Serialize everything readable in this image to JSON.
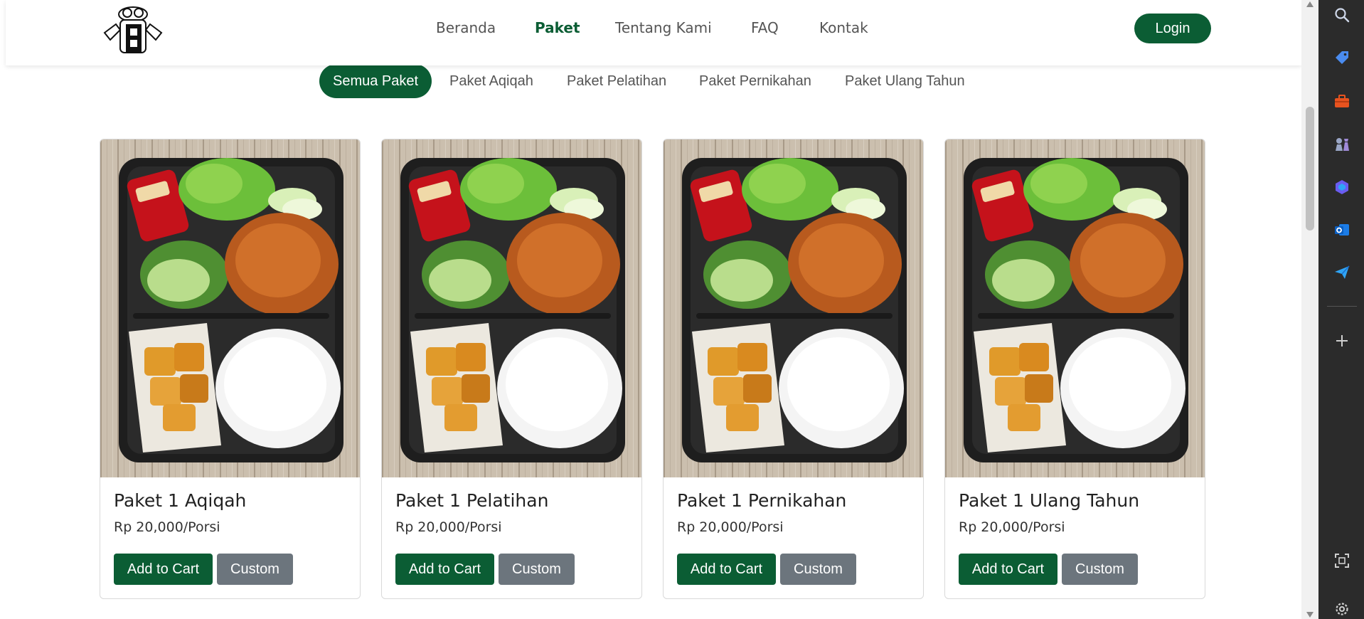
{
  "header": {
    "nav": [
      {
        "label": "Beranda",
        "active": false
      },
      {
        "label": "Paket",
        "active": true
      },
      {
        "label": "Tentang Kami",
        "active": false
      },
      {
        "label": "FAQ",
        "active": false
      },
      {
        "label": "Kontak",
        "active": false
      }
    ],
    "login_label": "Login"
  },
  "filters": [
    {
      "label": "Semua Paket",
      "active": true
    },
    {
      "label": "Paket Aqiqah",
      "active": false
    },
    {
      "label": "Paket Pelatihan",
      "active": false
    },
    {
      "label": "Paket Pernikahan",
      "active": false
    },
    {
      "label": "Paket Ulang Tahun",
      "active": false
    }
  ],
  "cards": [
    {
      "title": "Paket 1 Aqiqah",
      "price": "Rp 20,000/Porsi",
      "add_label": "Add to Cart",
      "custom_label": "Custom"
    },
    {
      "title": "Paket 1 Pelatihan",
      "price": "Rp 20,000/Porsi",
      "add_label": "Add to Cart",
      "custom_label": "Custom"
    },
    {
      "title": "Paket 1 Pernikahan",
      "price": "Rp 20,000/Porsi",
      "add_label": "Add to Cart",
      "custom_label": "Custom"
    },
    {
      "title": "Paket 1 Ulang Tahun",
      "price": "Rp 20,000/Porsi",
      "add_label": "Add to Cart",
      "custom_label": "Custom"
    }
  ],
  "sidepanel": {
    "icons": [
      "search-icon",
      "tag-icon",
      "briefcase-icon",
      "chess-icon",
      "copilot-icon",
      "outlook-icon",
      "send-icon",
      "add-icon",
      "screenshot-icon",
      "settings-icon"
    ]
  },
  "colors": {
    "brand_green": "#0b5d34",
    "custom_gray": "#6c757d",
    "sidepanel_bg": "#2b2b2b"
  }
}
